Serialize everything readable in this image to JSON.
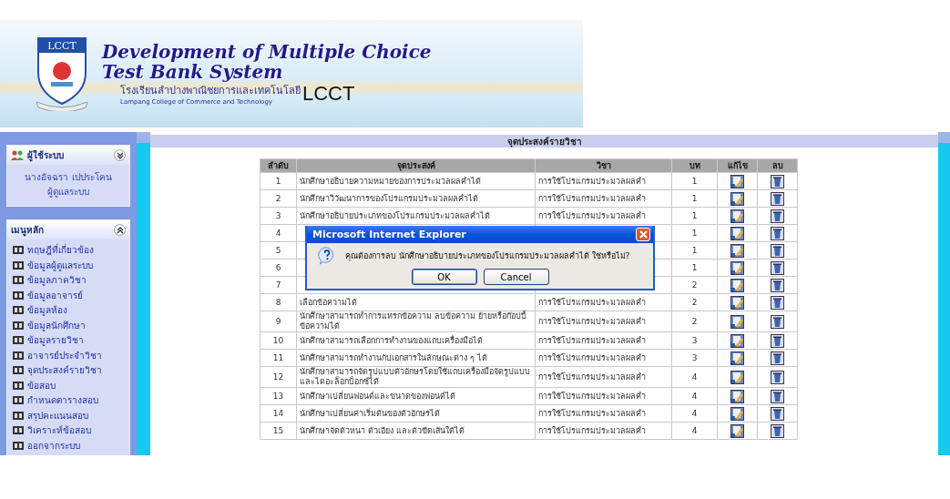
{
  "header": {
    "logo_text": "LCCT",
    "title_line_1": "Development of Multiple Choice",
    "title_line_2": "Test Bank System",
    "school_thai": "โรงเรียนลำปางพาณิชยการและเทคโนโลยี",
    "school_english": "Lampang College of Commerce and Technology",
    "brand": "LCCT"
  },
  "sidebar": {
    "user_panel": {
      "title": "ผู้ใช้ระบบ",
      "name": "นางอัจฉรา เปประโคน",
      "role": "ผู้ดูแลระบบ"
    },
    "menu_panel": {
      "title": "เมนูหลัก",
      "items": [
        "ทฤษฎีที่เกี่ยวข้อง",
        "ข้อมูลผู้ดูแลระบบ",
        "ข้อมูลภาควิชา",
        "ข้อมูลอาจารย์",
        "ข้อมูลห้อง",
        "ข้อมูลนักศึกษา",
        "ข้อมูลรายวิชา",
        "อาจารย์ประจำวิชา",
        "จุดประสงค์รายวิชา",
        "ข้อสอบ",
        "กำหนดตารางสอบ",
        "สรุปคะแนนสอบ",
        "วิเคราะห์ข้อสอบ",
        "ออกจากระบบ"
      ]
    }
  },
  "page_title": "จุดประสงค์รายวิชา",
  "table": {
    "columns": [
      "ลำดับ",
      "จุดประสงค์",
      "วิชา",
      "บท",
      "แก้ไข",
      "ลบ"
    ],
    "rows": [
      {
        "no": "1",
        "objective": "นักศึกษาอธิบายความหมายของการประมวลผลคำได้",
        "subject": "การใช้โปรแกรมประมวลผลคำ",
        "chapter": "1"
      },
      {
        "no": "2",
        "objective": "นักศึกษาวิวัฒนาการของโปรแกรมประมวลผลคำได้",
        "subject": "การใช้โปรแกรมประมวลผลคำ",
        "chapter": "1"
      },
      {
        "no": "3",
        "objective": "นักศึกษาอธิบายประเภทของโปรแกรมประมวลผลคำได้",
        "subject": "การใช้โปรแกรมประมวลผลคำ",
        "chapter": "1"
      },
      {
        "no": "4",
        "chapter": "1"
      },
      {
        "no": "5",
        "chapter": "1"
      },
      {
        "no": "6",
        "chapter": "1"
      },
      {
        "no": "7",
        "chapter": "2"
      },
      {
        "no": "8",
        "objective": "เลือกข้อความได้",
        "subject": "การใช้โปรแกรมประมวลผลคำ",
        "chapter": "2"
      },
      {
        "no": "9",
        "objective": "นักศึกษาสามารถทำการแทรกข้อความ ลบข้อความ ย้ายหรือก๊อปปี้ข้อความได้",
        "subject": "การใช้โปรแกรมประมวลผลคำ",
        "chapter": "2"
      },
      {
        "no": "10",
        "objective": "นักศึกษาสามารถเลือกการทำงานของแถบเครื่องมือได้",
        "subject": "การใช้โปรแกรมประมวลผลคำ",
        "chapter": "3"
      },
      {
        "no": "11",
        "objective": "นักศึกษาสามารถทำงานกับเอกสารในลักษณะต่าง ๆ ได้",
        "subject": "การใช้โปรแกรมประมวลผลคำ",
        "chapter": "3"
      },
      {
        "no": "12",
        "objective": "นักศึกษาสามารถจัดรูปแบบตัวอักษรโดยใช้แถบเครื่องมือจัดรูปแบบและไดอะล็อกบ็อกซ์ได้",
        "subject": "การใช้โปรแกรมประมวลผลคำ",
        "chapter": "4"
      },
      {
        "no": "13",
        "objective": "นักศึกษาเปลี่ยนฟอนต์และขนาดของฟอนต์ได้",
        "subject": "การใช้โปรแกรมประมวลผลคำ",
        "chapter": "4"
      },
      {
        "no": "14",
        "objective": "นักศึกษาเปลี่ยนค่าเริ่มต้นของตัวอักษรได้",
        "subject": "การใช้โปรแกรมประมวลผลคำ",
        "chapter": "4"
      },
      {
        "no": "15",
        "objective": "นักศึกษาจัดตัวหนา ตัวเอียง และตัวขีดเส้นใต้ได้",
        "subject": "การใช้โปรแกรมประมวลผลคำ",
        "chapter": "4"
      }
    ]
  },
  "dialog": {
    "title": "Microsoft Internet Explorer",
    "message": "คุณต้องการลบ นักศึกษาอธิบายประเภทของโปรแกรมประมวลผลคำได้ ใช่หรือไม่?",
    "buttons": [
      "OK",
      "Cancel"
    ]
  }
}
